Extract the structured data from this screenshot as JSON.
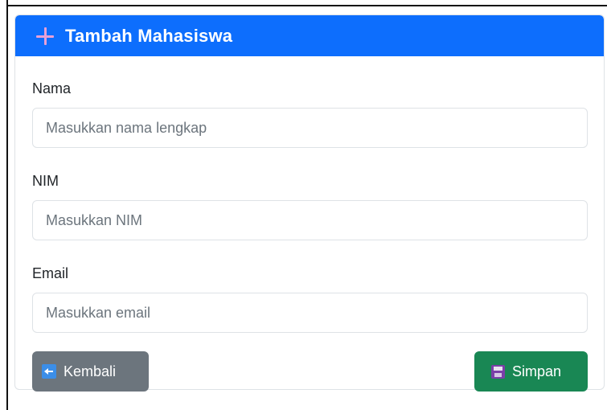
{
  "header": {
    "title": "Tambah Mahasiswa",
    "icon": "plus-icon",
    "color": "#0d6efd"
  },
  "form": {
    "nama": {
      "label": "Nama",
      "placeholder": "Masukkan nama lengkap",
      "value": ""
    },
    "nim": {
      "label": "NIM",
      "placeholder": "Masukkan NIM",
      "value": ""
    },
    "email": {
      "label": "Email",
      "placeholder": "Masukkan email",
      "value": ""
    }
  },
  "actions": {
    "back_label": "Kembali",
    "back_icon": "back-arrow-icon",
    "back_color": "#6c757d",
    "save_label": "Simpan",
    "save_icon": "floppy-disk-icon",
    "save_color": "#198754"
  }
}
